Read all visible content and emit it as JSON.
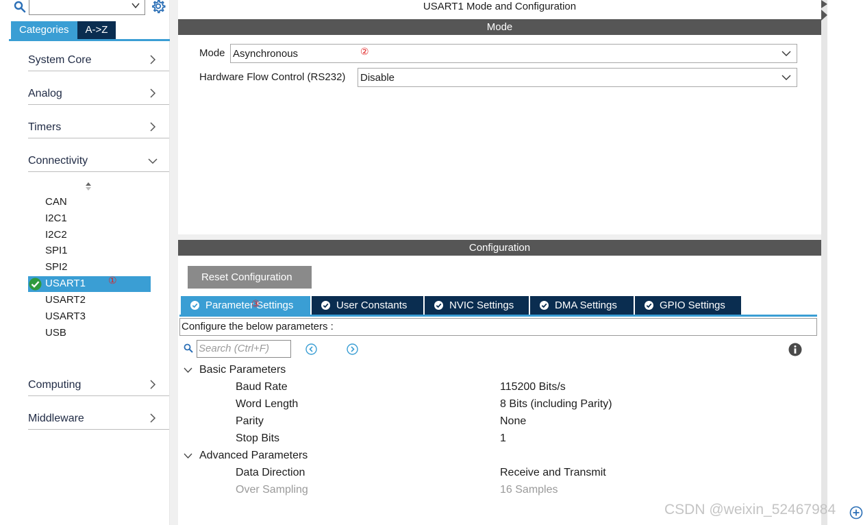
{
  "sidebar": {
    "search_value": "",
    "tabs": [
      "Categories",
      "A->Z"
    ],
    "categories": [
      {
        "label": "System Core",
        "expanded": false
      },
      {
        "label": "Analog",
        "expanded": false
      },
      {
        "label": "Timers",
        "expanded": false
      },
      {
        "label": "Connectivity",
        "expanded": true
      },
      {
        "label": "Computing",
        "expanded": false
      },
      {
        "label": "Middleware",
        "expanded": false
      }
    ],
    "connectivity_items": [
      "CAN",
      "I2C1",
      "I2C2",
      "SPI1",
      "SPI2",
      "USART1",
      "USART2",
      "USART3",
      "USB"
    ],
    "selected_item": "USART1"
  },
  "annotations": {
    "one": "①",
    "two": "②",
    "three": "③"
  },
  "window": {
    "title": "USART1 Mode and Configuration"
  },
  "mode": {
    "section_title": "Mode",
    "mode_label": "Mode",
    "mode_value": "Asynchronous",
    "hw_label": "Hardware Flow Control (RS232)",
    "hw_value": "Disable"
  },
  "config": {
    "section_title": "Configuration",
    "reset_label": "Reset Configuration",
    "tabs": [
      "Parameter Settings",
      "User Constants",
      "NVIC Settings",
      "DMA Settings",
      "GPIO Settings"
    ],
    "hint": "Configure the below parameters :",
    "search_placeholder": "Search (Ctrl+F)",
    "groups": [
      {
        "name": "Basic Parameters",
        "params": [
          {
            "name": "Baud Rate",
            "value": "115200 Bits/s"
          },
          {
            "name": "Word Length",
            "value": "8 Bits (including Parity)"
          },
          {
            "name": "Parity",
            "value": "None"
          },
          {
            "name": "Stop Bits",
            "value": "1"
          }
        ]
      },
      {
        "name": "Advanced Parameters",
        "params": [
          {
            "name": "Data Direction",
            "value": "Receive and Transmit"
          },
          {
            "name": "Over Sampling",
            "value": "16 Samples"
          }
        ]
      }
    ]
  },
  "watermark": "CSDN @weixin_52467984",
  "colors": {
    "accent": "#3a9ed4",
    "navy": "#0a2d50",
    "bar": "#565656",
    "red": "#e02020"
  }
}
